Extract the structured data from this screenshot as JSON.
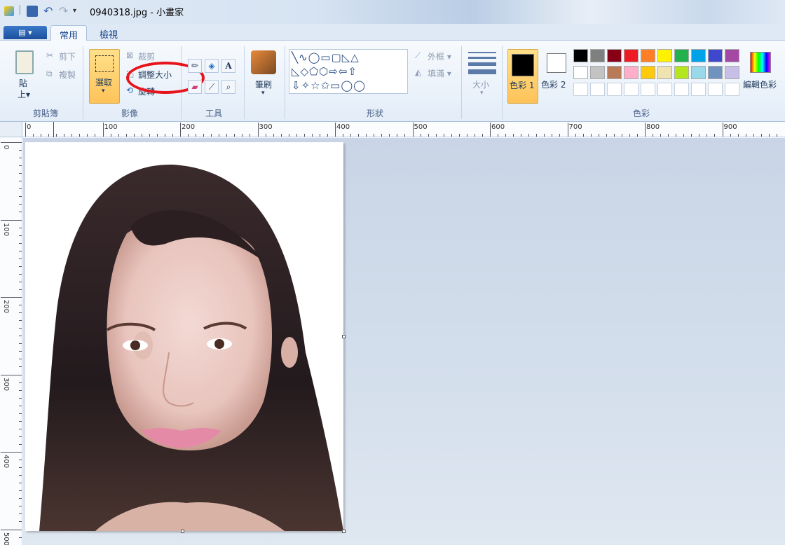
{
  "window": {
    "title": "0940318.jpg - 小畫家"
  },
  "tabs": [
    {
      "label": "常用",
      "active": true
    },
    {
      "label": "檢視",
      "active": false
    }
  ],
  "ribbon": {
    "clipboard": {
      "paste": "貼",
      "paste2": "上▾",
      "cut": "剪下",
      "copy": "複製",
      "group": "剪貼簿"
    },
    "image": {
      "select": "選取",
      "crop": "裁剪",
      "resize": "調整大小",
      "rotate": "旋轉",
      "group": "影像"
    },
    "tools": {
      "group": "工具"
    },
    "brushes": {
      "label": "筆刷"
    },
    "shapes": {
      "row1": "╲∿◯▭▢◺△",
      "row2": "◺◇⬠⬡⇨⇦⇧",
      "row3": "⇩✧☆✩▭◯◯",
      "outline": "外框 ▾",
      "fill": "填滿 ▾",
      "group": "形狀"
    },
    "size": {
      "label": "大小"
    },
    "colors": {
      "color1": "色彩 1",
      "color2": "色彩 2",
      "edit": "編輯色彩",
      "group": "色彩",
      "palette_row1": [
        "#000000",
        "#7f7f7f",
        "#880015",
        "#ed1c24",
        "#ff7f27",
        "#fff200",
        "#22b14c",
        "#00a2e8",
        "#3f48cc",
        "#a349a4"
      ],
      "palette_row2": [
        "#ffffff",
        "#c3c3c3",
        "#b97a57",
        "#ffaec9",
        "#ffc90e",
        "#efe4b0",
        "#b5e61d",
        "#99d9ea",
        "#7092be",
        "#c8bfe7"
      ]
    }
  },
  "rulers": {
    "h_labels": [
      "0",
      "100",
      "200",
      "300",
      "400",
      "500",
      "600",
      "700",
      "800",
      "900"
    ],
    "v_labels": [
      "0",
      "100",
      "200",
      "300",
      "400",
      "500"
    ]
  },
  "annotation": {
    "highlight": "調整大小"
  }
}
